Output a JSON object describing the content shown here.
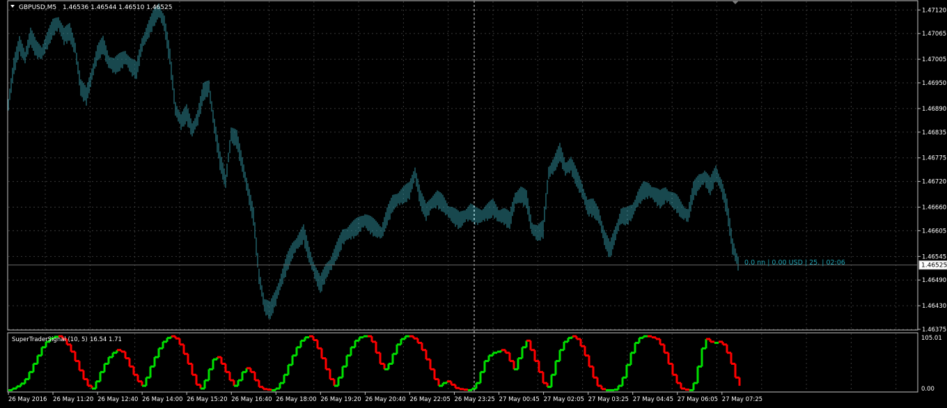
{
  "header": {
    "symbol_label": "GBPUSD,M5",
    "ohlc_label": "1.46536 1.46544 1.46510 1.46525"
  },
  "info_overlay": "0.0 nn | 0.00 USD | 25. | 02:06",
  "current_price_label": "1.46525",
  "indicator": {
    "title": "SuperTraderSignal (10, 5)",
    "values_label": "16.54 1.71",
    "scale_top_label": "105.01",
    "scale_bottom_label": "0.00"
  },
  "colors": {
    "background": "#000000",
    "candles": "#2f8f9d",
    "grid": "#3a3a3a",
    "frame": "#c8c8c8",
    "overlay_text": "#1fa3b3",
    "signal_up": "#00e000",
    "signal_down": "#ff0000"
  },
  "chart_data": {
    "type": "line",
    "title": "GBPUSD,M5",
    "price_ticks": [
      "1.47120",
      "1.47065",
      "1.47005",
      "1.46950",
      "1.46890",
      "1.46835",
      "1.46775",
      "1.46720",
      "1.46660",
      "1.46605",
      "1.46545",
      "1.46490",
      "1.46430",
      "1.46375"
    ],
    "price_range": [
      1.46375,
      1.4714
    ],
    "time_labels": [
      "26 May 2016",
      "26 May 11:20",
      "26 May 12:40",
      "26 May 14:00",
      "26 May 15:20",
      "26 May 16:40",
      "26 May 18:00",
      "26 May 19:20",
      "26 May 20:40",
      "26 May 22:05",
      "26 May 23:25",
      "27 May 00:45",
      "27 May 02:05",
      "27 May 03:25",
      "27 May 04:45",
      "27 May 06:05",
      "27 May 07:25"
    ],
    "current_price": 1.46525,
    "series": [
      {
        "type": "line",
        "points": [
          [
            0,
            1.469
          ],
          [
            8,
            1.4699
          ],
          [
            16,
            1.4704
          ],
          [
            24,
            1.4701
          ],
          [
            32,
            1.4706
          ],
          [
            40,
            1.4703
          ],
          [
            48,
            1.4702
          ],
          [
            56,
            1.4705
          ],
          [
            64,
            1.4708
          ],
          [
            72,
            1.4709
          ],
          [
            80,
            1.4706
          ],
          [
            88,
            1.4707
          ],
          [
            96,
            1.4703
          ],
          [
            104,
            1.4694
          ],
          [
            112,
            1.4692
          ],
          [
            120,
            1.4697
          ],
          [
            128,
            1.4702
          ],
          [
            136,
            1.4704
          ],
          [
            144,
            1.47
          ],
          [
            152,
            1.4699
          ],
          [
            160,
            1.47
          ],
          [
            168,
            1.4701
          ],
          [
            176,
            1.4699
          ],
          [
            184,
            1.4698
          ],
          [
            192,
            1.4704
          ],
          [
            200,
            1.4707
          ],
          [
            208,
            1.471
          ],
          [
            216,
            1.4712
          ],
          [
            224,
            1.4709
          ],
          [
            232,
            1.4701
          ],
          [
            240,
            1.4689
          ],
          [
            248,
            1.4686
          ],
          [
            256,
            1.4688
          ],
          [
            264,
            1.4684
          ],
          [
            272,
            1.4687
          ],
          [
            280,
            1.4693
          ],
          [
            288,
            1.4694
          ],
          [
            296,
            1.4685
          ],
          [
            304,
            1.4677
          ],
          [
            312,
            1.4672
          ],
          [
            320,
            1.4683
          ],
          [
            328,
            1.4682
          ],
          [
            336,
            1.4676
          ],
          [
            344,
            1.467
          ],
          [
            352,
            1.4664
          ],
          [
            360,
            1.465
          ],
          [
            368,
            1.4643
          ],
          [
            376,
            1.4642
          ],
          [
            384,
            1.4645
          ],
          [
            392,
            1.4649
          ],
          [
            400,
            1.4653
          ],
          [
            408,
            1.4656
          ],
          [
            416,
            1.4658
          ],
          [
            424,
            1.466
          ],
          [
            432,
            1.4655
          ],
          [
            440,
            1.4651
          ],
          [
            448,
            1.4648
          ],
          [
            456,
            1.4651
          ],
          [
            464,
            1.4653
          ],
          [
            472,
            1.4656
          ],
          [
            480,
            1.4659
          ],
          [
            488,
            1.466
          ],
          [
            496,
            1.4661
          ],
          [
            504,
            1.4662
          ],
          [
            512,
            1.4663
          ],
          [
            520,
            1.4662
          ],
          [
            528,
            1.4661
          ],
          [
            536,
            1.466
          ],
          [
            544,
            1.4664
          ],
          [
            552,
            1.4667
          ],
          [
            560,
            1.4668
          ],
          [
            568,
            1.4669
          ],
          [
            576,
            1.467
          ],
          [
            584,
            1.4674
          ],
          [
            592,
            1.4668
          ],
          [
            600,
            1.4665
          ],
          [
            608,
            1.4667
          ],
          [
            616,
            1.4668
          ],
          [
            624,
            1.4667
          ],
          [
            632,
            1.4665
          ],
          [
            640,
            1.4664
          ],
          [
            648,
            1.4663
          ],
          [
            656,
            1.4664
          ],
          [
            664,
            1.4665
          ],
          [
            672,
            1.4664
          ],
          [
            680,
            1.4664
          ],
          [
            688,
            1.4665
          ],
          [
            696,
            1.4666
          ],
          [
            704,
            1.4664
          ],
          [
            712,
            1.4664
          ],
          [
            720,
            1.4663
          ],
          [
            728,
            1.4668
          ],
          [
            736,
            1.4669
          ],
          [
            744,
            1.4668
          ],
          [
            752,
            1.4661
          ],
          [
            760,
            1.466
          ],
          [
            768,
            1.4661
          ],
          [
            776,
            1.4674
          ],
          [
            784,
            1.4676
          ],
          [
            792,
            1.4679
          ],
          [
            800,
            1.4675
          ],
          [
            808,
            1.4676
          ],
          [
            816,
            1.4673
          ],
          [
            824,
            1.467
          ],
          [
            832,
            1.4666
          ],
          [
            840,
            1.4666
          ],
          [
            848,
            1.4664
          ],
          [
            856,
            1.4659
          ],
          [
            864,
            1.4656
          ],
          [
            872,
            1.466
          ],
          [
            880,
            1.4664
          ],
          [
            888,
            1.4664
          ],
          [
            896,
            1.4665
          ],
          [
            904,
            1.4668
          ],
          [
            912,
            1.467
          ],
          [
            920,
            1.467
          ],
          [
            928,
            1.4669
          ],
          [
            936,
            1.4668
          ],
          [
            944,
            1.4669
          ],
          [
            952,
            1.4668
          ],
          [
            960,
            1.4667
          ],
          [
            968,
            1.4665
          ],
          [
            976,
            1.4664
          ],
          [
            984,
            1.467
          ],
          [
            992,
            1.4672
          ],
          [
            1000,
            1.4673
          ],
          [
            1008,
            1.4671
          ],
          [
            1016,
            1.4674
          ],
          [
            1024,
            1.4671
          ],
          [
            1032,
            1.4666
          ],
          [
            1040,
            1.4657
          ],
          [
            1048,
            1.4653
          ]
        ]
      },
      {
        "type": "line",
        "points": [
          [
            0,
            2
          ],
          [
            6,
            5
          ],
          [
            12,
            9
          ],
          [
            18,
            14
          ],
          [
            24,
            22
          ],
          [
            30,
            35
          ],
          [
            36,
            50
          ],
          [
            42,
            65
          ],
          [
            48,
            80
          ],
          [
            54,
            90
          ],
          [
            60,
            96
          ],
          [
            66,
            99
          ],
          [
            72,
            100
          ],
          [
            78,
            95
          ],
          [
            84,
            85
          ],
          [
            90,
            72
          ],
          [
            96,
            55
          ],
          [
            102,
            38
          ],
          [
            108,
            22
          ],
          [
            114,
            10
          ],
          [
            120,
            5
          ],
          [
            126,
            18
          ],
          [
            132,
            35
          ],
          [
            138,
            50
          ],
          [
            144,
            62
          ],
          [
            150,
            70
          ],
          [
            156,
            75
          ],
          [
            162,
            72
          ],
          [
            168,
            60
          ],
          [
            174,
            45
          ],
          [
            180,
            30
          ],
          [
            186,
            18
          ],
          [
            192,
            10
          ],
          [
            198,
            25
          ],
          [
            204,
            45
          ],
          [
            210,
            62
          ],
          [
            216,
            78
          ],
          [
            222,
            90
          ],
          [
            228,
            97
          ],
          [
            234,
            100
          ],
          [
            240,
            96
          ],
          [
            246,
            85
          ],
          [
            252,
            68
          ],
          [
            258,
            50
          ],
          [
            264,
            30
          ],
          [
            270,
            12
          ],
          [
            276,
            5
          ],
          [
            282,
            20
          ],
          [
            288,
            40
          ],
          [
            294,
            58
          ],
          [
            300,
            62
          ],
          [
            306,
            50
          ],
          [
            312,
            35
          ],
          [
            318,
            20
          ],
          [
            324,
            10
          ],
          [
            330,
            20
          ],
          [
            336,
            35
          ],
          [
            342,
            42
          ],
          [
            348,
            35
          ],
          [
            354,
            20
          ],
          [
            360,
            8
          ],
          [
            366,
            4
          ],
          [
            372,
            3
          ],
          [
            378,
            2
          ],
          [
            384,
            5
          ],
          [
            390,
            15
          ],
          [
            396,
            30
          ],
          [
            402,
            48
          ],
          [
            408,
            65
          ],
          [
            414,
            80
          ],
          [
            420,
            92
          ],
          [
            426,
            98
          ],
          [
            432,
            100
          ],
          [
            438,
            93
          ],
          [
            444,
            78
          ],
          [
            450,
            60
          ],
          [
            456,
            40
          ],
          [
            462,
            22
          ],
          [
            468,
            10
          ],
          [
            474,
            25
          ],
          [
            480,
            45
          ],
          [
            486,
            65
          ],
          [
            492,
            80
          ],
          [
            498,
            92
          ],
          [
            504,
            98
          ],
          [
            510,
            100
          ],
          [
            516,
            100
          ],
          [
            522,
            90
          ],
          [
            528,
            70
          ],
          [
            534,
            50
          ],
          [
            540,
            40
          ],
          [
            546,
            50
          ],
          [
            552,
            68
          ],
          [
            558,
            85
          ],
          [
            564,
            95
          ],
          [
            570,
            100
          ],
          [
            576,
            100
          ],
          [
            582,
            96
          ],
          [
            588,
            88
          ],
          [
            594,
            75
          ],
          [
            600,
            58
          ],
          [
            606,
            40
          ],
          [
            612,
            22
          ],
          [
            618,
            10
          ],
          [
            624,
            15
          ],
          [
            630,
            18
          ],
          [
            636,
            12
          ],
          [
            642,
            6
          ],
          [
            648,
            4
          ],
          [
            654,
            3
          ],
          [
            660,
            2
          ],
          [
            666,
            5
          ],
          [
            672,
            15
          ],
          [
            678,
            35
          ],
          [
            684,
            55
          ],
          [
            690,
            65
          ],
          [
            696,
            70
          ],
          [
            702,
            72
          ],
          [
            708,
            75
          ],
          [
            714,
            70
          ],
          [
            720,
            55
          ],
          [
            726,
            40
          ],
          [
            732,
            60
          ],
          [
            738,
            80
          ],
          [
            744,
            92
          ],
          [
            750,
            75
          ],
          [
            756,
            55
          ],
          [
            762,
            35
          ],
          [
            768,
            15
          ],
          [
            774,
            8
          ],
          [
            780,
            30
          ],
          [
            786,
            55
          ],
          [
            792,
            75
          ],
          [
            798,
            90
          ],
          [
            804,
            97
          ],
          [
            810,
            100
          ],
          [
            816,
            95
          ],
          [
            822,
            82
          ],
          [
            828,
            65
          ],
          [
            834,
            45
          ],
          [
            840,
            25
          ],
          [
            846,
            10
          ],
          [
            852,
            4
          ],
          [
            858,
            2
          ],
          [
            864,
            2
          ],
          [
            870,
            3
          ],
          [
            876,
            10
          ],
          [
            882,
            25
          ],
          [
            888,
            48
          ],
          [
            894,
            70
          ],
          [
            900,
            88
          ],
          [
            906,
            97
          ],
          [
            912,
            100
          ],
          [
            918,
            100
          ],
          [
            924,
            98
          ],
          [
            930,
            95
          ],
          [
            936,
            85
          ],
          [
            942,
            70
          ],
          [
            948,
            50
          ],
          [
            954,
            30
          ],
          [
            960,
            15
          ],
          [
            966,
            5
          ],
          [
            972,
            3
          ],
          [
            978,
            2
          ],
          [
            984,
            15
          ],
          [
            990,
            45
          ],
          [
            996,
            78
          ],
          [
            1002,
            95
          ],
          [
            1008,
            90
          ],
          [
            1014,
            88
          ],
          [
            1020,
            90
          ],
          [
            1026,
            85
          ],
          [
            1032,
            70
          ],
          [
            1038,
            50
          ],
          [
            1044,
            25
          ],
          [
            1050,
            10
          ]
        ]
      }
    ]
  }
}
